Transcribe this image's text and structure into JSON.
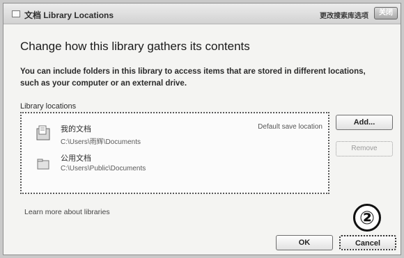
{
  "window": {
    "title": "文档 Library Locations",
    "help_text": "更改搜索库选项",
    "close_label": "关闭"
  },
  "heading": "Change how this library gathers its contents",
  "description": "You can include folders in this library to access items that are stored in different locations, such as your computer or an external drive.",
  "locations": {
    "caption": "Library locations",
    "items": [
      {
        "name": "我的文档",
        "path": "C:\\Users\\雨辉\\Documents",
        "tag": "Default save location",
        "icon": "documents-folder-icon"
      },
      {
        "name": "公用文档",
        "path": "C:\\Users\\Public\\Documents",
        "tag": "",
        "icon": "public-documents-folder-icon"
      }
    ]
  },
  "buttons": {
    "add": "Add...",
    "remove": "Remove",
    "ok": "OK",
    "cancel": "Cancel"
  },
  "learn_more": "Learn more about libraries",
  "annotation": "②"
}
